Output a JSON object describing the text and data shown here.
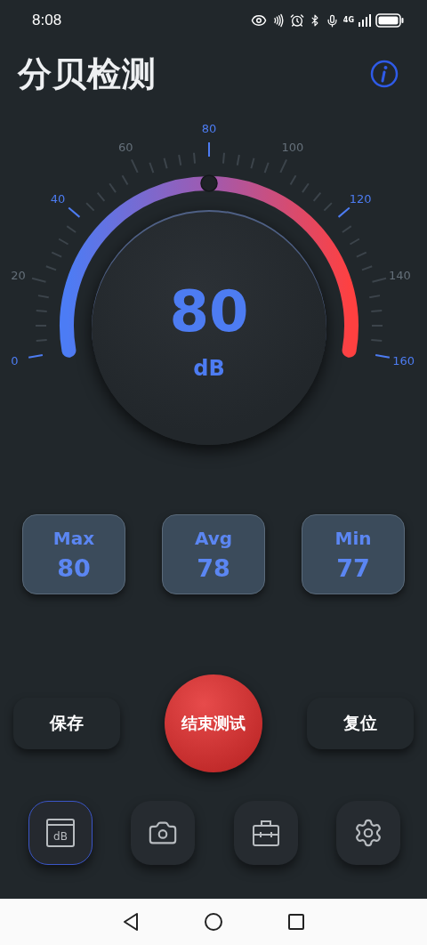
{
  "status_bar": {
    "time": "8:08",
    "network": "4G"
  },
  "header": {
    "title": "分贝检测"
  },
  "gauge": {
    "reading": "80",
    "unit": "dB",
    "tick_labels": [
      {
        "label": "0",
        "highlighted": true
      },
      {
        "label": "20",
        "highlighted": false
      },
      {
        "label": "40",
        "highlighted": true
      },
      {
        "label": "60",
        "highlighted": false
      },
      {
        "label": "80",
        "highlighted": true
      },
      {
        "label": "100",
        "highlighted": false
      },
      {
        "label": "120",
        "highlighted": true
      },
      {
        "label": "140",
        "highlighted": false
      },
      {
        "label": "160",
        "highlighted": true
      }
    ]
  },
  "stats": [
    {
      "label": "Max",
      "value": "80"
    },
    {
      "label": "Avg",
      "value": "78"
    },
    {
      "label": "Min",
      "value": "77"
    }
  ],
  "actions": [
    {
      "kind": "plain",
      "label": "保存"
    },
    {
      "kind": "primary",
      "label": "结束测试"
    },
    {
      "kind": "plain",
      "label": "复位"
    }
  ],
  "nav": [
    {
      "kind": "meter",
      "label": "dB",
      "selected": true
    },
    {
      "kind": "camera",
      "selected": false
    },
    {
      "kind": "toolbox",
      "selected": false
    },
    {
      "kind": "settings",
      "selected": false
    }
  ]
}
